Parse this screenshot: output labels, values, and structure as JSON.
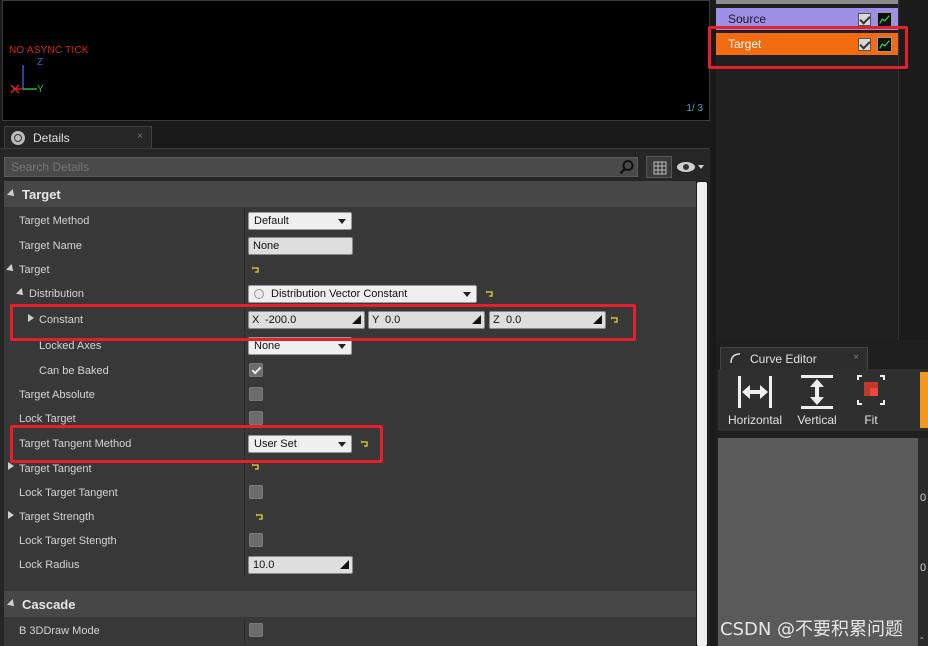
{
  "viewport": {
    "status_text": "NO ASYNC TICK",
    "page_counter": "1/  3",
    "axis_z": "Z",
    "axis_y": "Y"
  },
  "emitters": {
    "items": [
      {
        "label": "Source"
      },
      {
        "label": "Target"
      }
    ]
  },
  "details": {
    "tab_label": "Details",
    "tab_close": "×",
    "search_placeholder": "Search Details",
    "sections": {
      "target": "Target",
      "cascade": "Cascade"
    },
    "rows": {
      "target_method": {
        "name": "Target Method",
        "value": "Default"
      },
      "target_name": {
        "name": "Target Name",
        "value": "None"
      },
      "target_group": {
        "name": "Target"
      },
      "distribution": {
        "name": "Distribution",
        "value": "Distribution Vector Constant"
      },
      "constant": {
        "name": "Constant",
        "x_label": "X",
        "x": "-200.0",
        "y_label": "Y",
        "y": "0.0",
        "z_label": "Z",
        "z": "0.0"
      },
      "locked_axes": {
        "name": "Locked Axes",
        "value": "None"
      },
      "can_be_baked": {
        "name": "Can be Baked",
        "checked": true
      },
      "target_absolute": {
        "name": "Target Absolute",
        "checked": false
      },
      "lock_target": {
        "name": "Lock Target",
        "checked": false
      },
      "target_tangent_method": {
        "name": "Target Tangent Method",
        "value": "User Set"
      },
      "target_tangent": {
        "name": "Target Tangent"
      },
      "lock_target_tangent": {
        "name": "Lock Target Tangent",
        "checked": false
      },
      "target_strength": {
        "name": "Target Strength"
      },
      "lock_target_strength": {
        "name": "Lock Target Stength",
        "checked": false
      },
      "lock_radius": {
        "name": "Lock Radius",
        "value": "10.0"
      },
      "b_3ddraw_mode": {
        "name": "B 3DDraw Mode",
        "checked": false
      }
    }
  },
  "curve_editor": {
    "tab_label": "Curve Editor",
    "tab_close": "×",
    "buttons": {
      "horizontal": "Horizontal",
      "vertical": "Vertical",
      "fit": "Fit"
    },
    "axis_values": [
      "0",
      "0",
      "-"
    ]
  },
  "watermark": "CSDN @不要积累问题",
  "colors": {
    "source_row": "#9f8fe6",
    "target_row": "#f26b10",
    "highlight_box": "#e6202a",
    "accent_orange": "#f39a1e"
  }
}
